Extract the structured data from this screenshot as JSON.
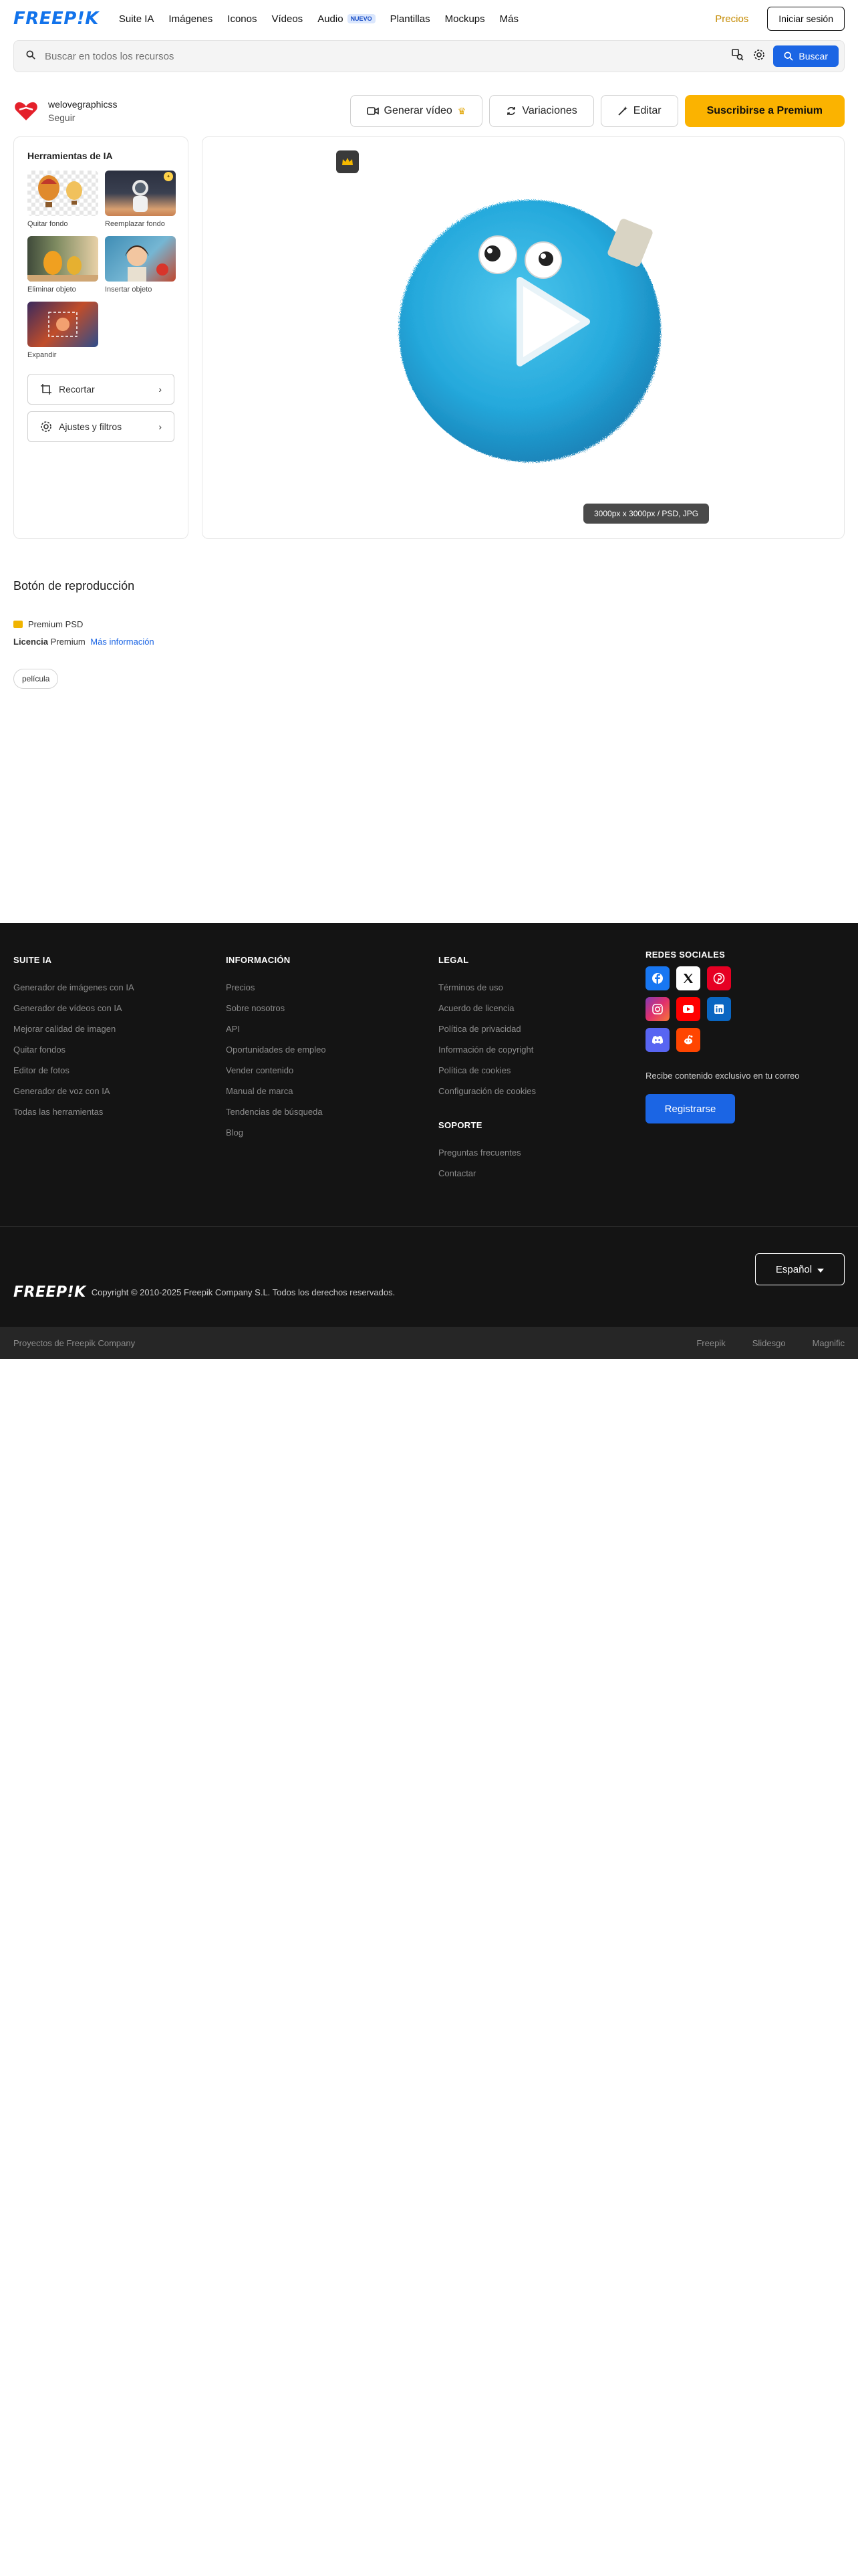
{
  "header": {
    "logo": "FREEP!K",
    "nav": [
      {
        "label": "Suite IA"
      },
      {
        "label": "Imágenes"
      },
      {
        "label": "Iconos"
      },
      {
        "label": "Vídeos"
      },
      {
        "label": "Audio",
        "badge": "NUEVO"
      },
      {
        "label": "Plantillas"
      },
      {
        "label": "Mockups"
      },
      {
        "label": "Más"
      }
    ],
    "pricing": "Precios",
    "login": "Iniciar sesión"
  },
  "search": {
    "placeholder": "Buscar en todos los recursos",
    "button": "Buscar"
  },
  "author": {
    "name": "welovegraphicss",
    "follow": "Seguir"
  },
  "actions": {
    "generate_video": "Generar vídeo",
    "variations": "Variaciones",
    "edit": "Editar",
    "subscribe": "Suscribirse a Premium"
  },
  "ai_tools": {
    "title": "Herramientas de IA",
    "items": [
      {
        "label": "Quitar fondo"
      },
      {
        "label": "Reemplazar fondo"
      },
      {
        "label": "Eliminar objeto"
      },
      {
        "label": "Insertar objeto"
      },
      {
        "label": "Expandir"
      }
    ],
    "crop": "Recortar",
    "adjust": "Ajustes y filtros"
  },
  "preview": {
    "dimensions": "3000px x 3000px / PSD, JPG"
  },
  "asset": {
    "title": "Botón de reproducción",
    "type": "Premium PSD",
    "license_label": "Licencia",
    "license_value": "Premium",
    "more_info": "Más información",
    "tag": "película"
  },
  "footer": {
    "col1": {
      "title": "SUITE IA",
      "links": [
        "Generador de imágenes con IA",
        "Generador de vídeos con IA",
        "Mejorar calidad de imagen",
        "Quitar fondos",
        "Editor de fotos",
        "Generador de voz con IA",
        "Todas las herramientas"
      ]
    },
    "col2": {
      "title": "INFORMACIÓN",
      "links": [
        "Precios",
        "Sobre nosotros",
        "API",
        "Oportunidades de empleo",
        "Vender contenido",
        "Manual de marca",
        "Tendencias de búsqueda",
        "Blog"
      ]
    },
    "col3": {
      "title": "LEGAL",
      "links": [
        "Términos de uso",
        "Acuerdo de licencia",
        "Política de privacidad",
        "Información de copyright",
        "Política de cookies",
        "Configuración de cookies"
      ]
    },
    "col3b": {
      "title": "SOPORTE",
      "links": [
        "Preguntas frecuentes",
        "Contactar"
      ]
    },
    "social": {
      "title": "REDES SOCIALES",
      "icons": [
        {
          "name": "facebook-icon",
          "color": "#1877f2"
        },
        {
          "name": "x-icon",
          "color": "#ffffff"
        },
        {
          "name": "pinterest-icon",
          "color": "#e60023"
        },
        {
          "name": "instagram-icon",
          "color": "#c13584"
        },
        {
          "name": "youtube-icon",
          "color": "#ff0000"
        },
        {
          "name": "linkedin-icon",
          "color": "#0a66c2"
        },
        {
          "name": "discord-icon",
          "color": "#5865f2"
        },
        {
          "name": "reddit-icon",
          "color": "#ff4500"
        }
      ],
      "newsletter": "Recibe contenido exclusivo en tu correo",
      "register": "Registrarse"
    },
    "copyright": "Copyright © 2010-2025 Freepik Company S.L. Todos los derechos reservados.",
    "language": "Español",
    "company_projects": "Proyectos de Freepik Company",
    "bottom_links": [
      "Freepik",
      "Slidesgo",
      "Magnific"
    ]
  }
}
